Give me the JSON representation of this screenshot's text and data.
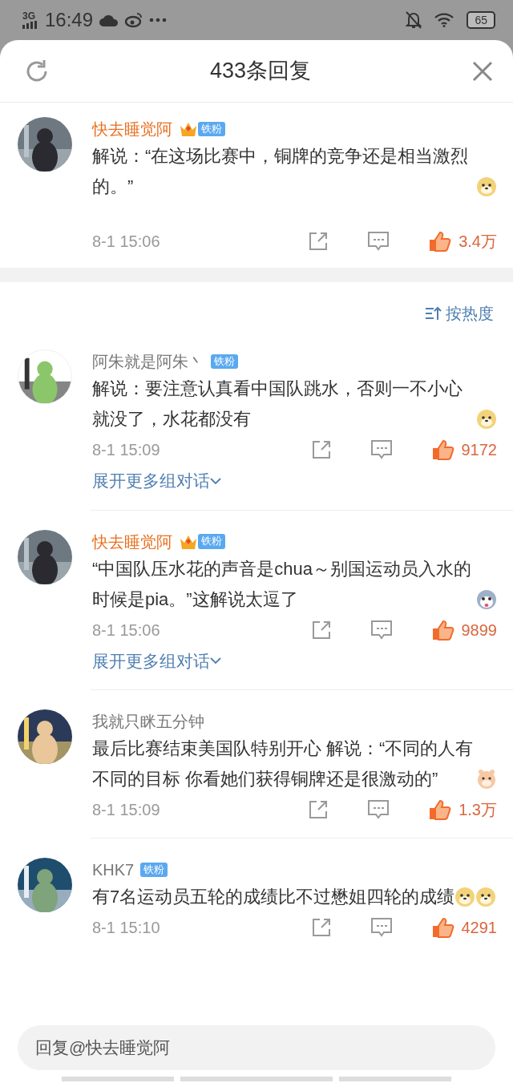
{
  "status_bar": {
    "network": "3G",
    "time": "16:49",
    "battery": "65"
  },
  "header": {
    "title": "433条回复"
  },
  "head_comment": {
    "user": "快去睡觉阿",
    "vip": true,
    "fan_badge": "铁粉",
    "text": "解说：“在这场比赛中，铜牌的竞争还是相当激烈的。”",
    "emojis": [
      {
        "kind": "doge"
      }
    ],
    "time": "8-1 15:06",
    "likes": "3.4万"
  },
  "sort": {
    "label": "按热度"
  },
  "comments": [
    {
      "user": "阿朱就是阿朱丶",
      "vip": false,
      "fan_badge": "铁粉",
      "text": "解说：要注意认真看中国队跳水，否则一不小心就没了，水花都没有",
      "emojis": [
        {
          "kind": "doge"
        }
      ],
      "time": "8-1 15:09",
      "likes": "9172",
      "more": "展开更多组对话"
    },
    {
      "user": "快去睡觉阿",
      "vip": true,
      "fan_badge": "铁粉",
      "text": "“中国队压水花的声音是chua～别国运动员入水的时候是pia。”这解说太逗了",
      "emojis": [
        {
          "kind": "husky"
        }
      ],
      "time": "8-1 15:06",
      "likes": "9899",
      "more": "展开更多组对话"
    },
    {
      "user": "我就只眯五分钟",
      "vip": false,
      "text": "最后比赛结束美国队特别开心 解说：“不同的人有不同的目标 你看她们获得铜牌还是很激动的”",
      "emojis": [
        {
          "kind": "hamster"
        }
      ],
      "time": "8-1 15:09",
      "likes": "1.3万"
    },
    {
      "user": "KHK7",
      "vip": false,
      "fan_badge": "铁粉",
      "text": "有7名运动员五轮的成绩比不过懋姐四轮的成绩",
      "emojis": [
        {
          "kind": "doge"
        },
        {
          "kind": "doge"
        }
      ],
      "time": "8-1 15:10",
      "likes": "4291"
    }
  ],
  "reply_field": {
    "placeholder": "回复@快去睡觉阿"
  }
}
